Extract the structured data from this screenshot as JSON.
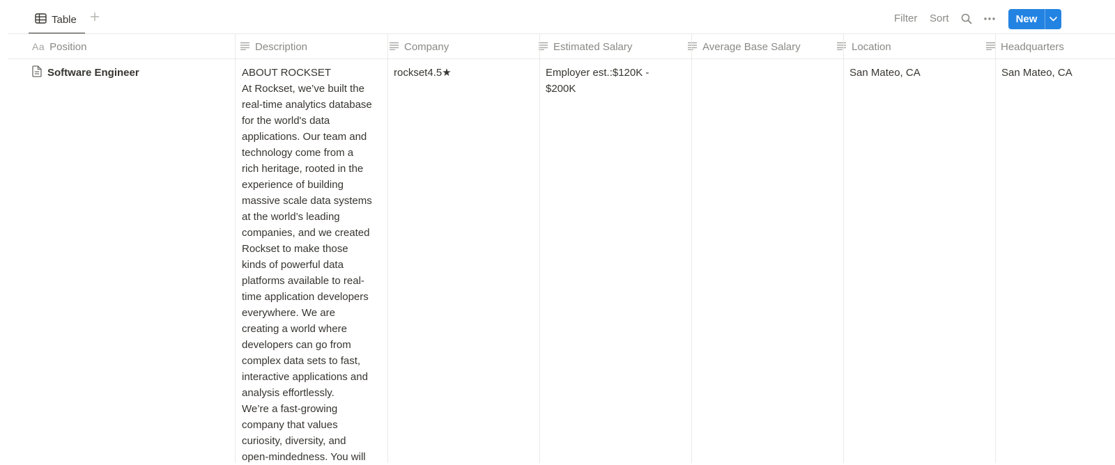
{
  "toolbar": {
    "view_tab_label": "Table",
    "filter_label": "Filter",
    "sort_label": "Sort",
    "new_label": "New",
    "accent_color": "#2383e2"
  },
  "columns": {
    "position": "Position",
    "description": "Description",
    "company": "Company",
    "estimated_salary": "Estimated Salary",
    "average_base_salary": "Average Base Salary",
    "location": "Location",
    "headquarters": "Headquarters"
  },
  "rows": [
    {
      "position": "Software Engineer",
      "description_lines": [
        "ABOUT ROCKSET",
        "At Rockset, we’ve built the",
        "real-time analytics database",
        "for the world's data",
        "applications. Our team and",
        "technology come from a",
        "rich heritage, rooted in the",
        "experience of building",
        "massive scale data systems",
        "at the world’s leading",
        "companies, and we created",
        "Rockset to make those",
        "kinds of powerful data",
        "platforms available to real-",
        "time application developers",
        "everywhere. We are",
        "creating a world where",
        "developers can go from",
        "complex data sets to fast,",
        "interactive applications and",
        "analysis effortlessly.",
        "We’re a fast-growing",
        "company that values",
        "curiosity, diversity, and",
        "open-mindedness. You will"
      ],
      "company": "rockset4.5★",
      "estimated_salary_lines": [
        "Employer est.:$120K -",
        "$200K"
      ],
      "average_base_salary": "",
      "location": "San Mateo, CA",
      "headquarters": "San Mateo, CA"
    }
  ]
}
